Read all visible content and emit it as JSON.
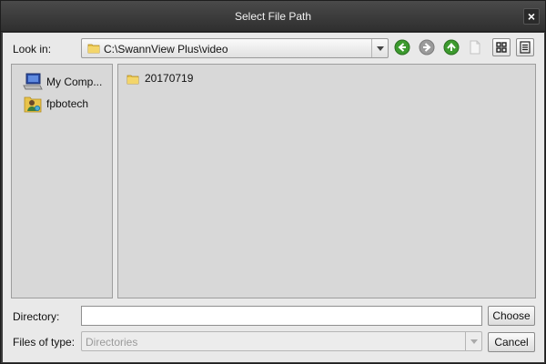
{
  "dialog": {
    "title": "Select File Path",
    "close_symbol": "×"
  },
  "lookin": {
    "label": "Look in:",
    "path": "C:\\SwannView Plus\\video"
  },
  "toolbar": {
    "icons": [
      "back-icon",
      "forward-icon",
      "parent-folder-icon",
      "new-folder-icon",
      "list-view-icon",
      "detail-view-icon"
    ]
  },
  "sidebar": {
    "items": [
      {
        "label": "My Comp...",
        "icon": "computer-icon"
      },
      {
        "label": "fpbotech",
        "icon": "user-folder-icon"
      }
    ]
  },
  "files": [
    {
      "name": "20170719",
      "icon": "folder-icon"
    }
  ],
  "directory": {
    "label": "Directory:",
    "value": "",
    "choose_label": "Choose"
  },
  "filetype": {
    "label": "Files of type:",
    "value": "Directories",
    "cancel_label": "Cancel"
  },
  "colors": {
    "titlebar": "#3a3a3a",
    "panel": "#e9e9e9",
    "list_bg": "#d8d8d8",
    "nav_green": "#3c9a2e"
  }
}
